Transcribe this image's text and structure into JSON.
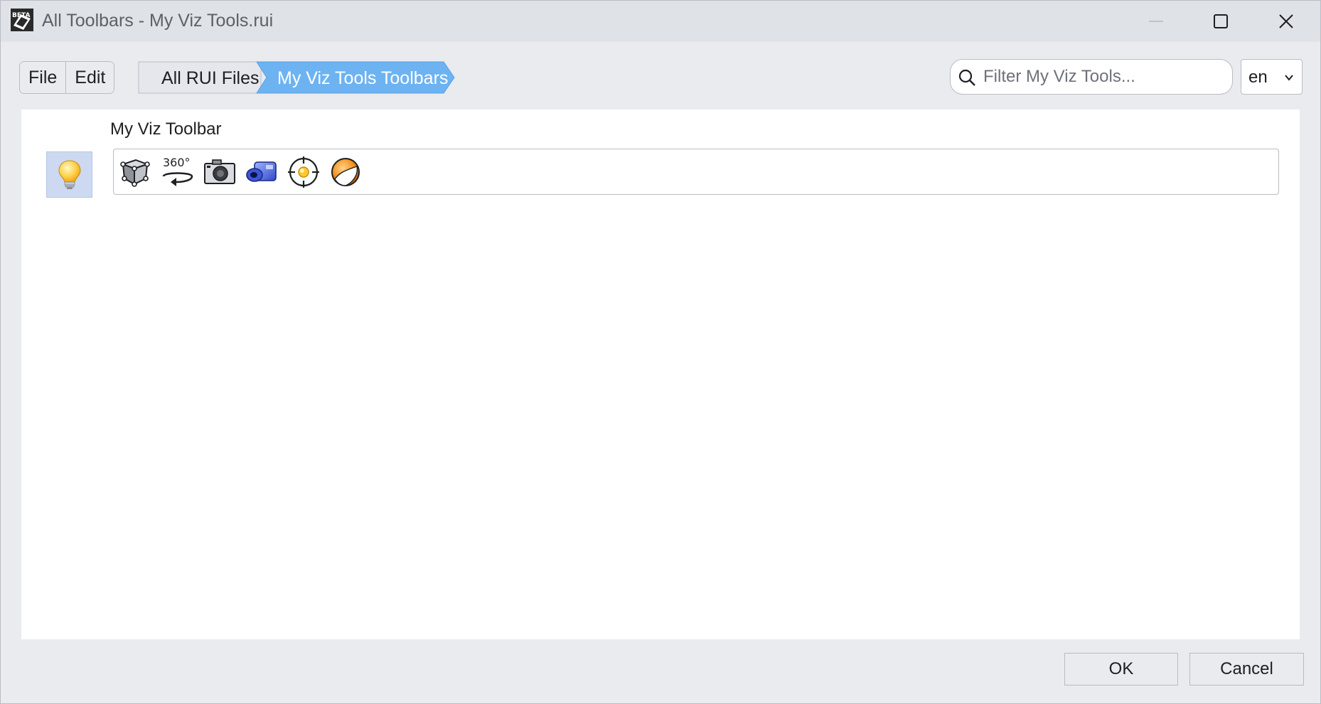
{
  "window": {
    "title": "All Toolbars - My Viz Tools.rui",
    "app_icon": "beta-app-icon",
    "controls": [
      "minimize-icon",
      "maximize-icon",
      "close-icon"
    ]
  },
  "menu": {
    "file_label": "File",
    "edit_label": "Edit"
  },
  "breadcrumb": {
    "items": [
      "All RUI Files",
      "My Viz Tools Toolbars"
    ],
    "active_color": "#6db3f2"
  },
  "search": {
    "placeholder": "Filter My Viz Tools...",
    "value": ""
  },
  "language": {
    "selected": "en"
  },
  "toolbar": {
    "name": "My Viz Toolbar",
    "badge_icon": "lightbulb-icon",
    "buttons": [
      "cube-wireframe-icon",
      "rotate-360-icon",
      "camera-icon",
      "blue-camera-icon",
      "target-crosshair-icon",
      "orange-sphere-icon"
    ],
    "button_text_360": "360°"
  },
  "footer": {
    "ok_label": "OK",
    "cancel_label": "Cancel"
  },
  "colors": {
    "window_bg": "#e9ebef",
    "titlebar_bg": "#dfe2e7",
    "badge_bg": "#cdd9f0",
    "accent": "#6db3f2"
  }
}
